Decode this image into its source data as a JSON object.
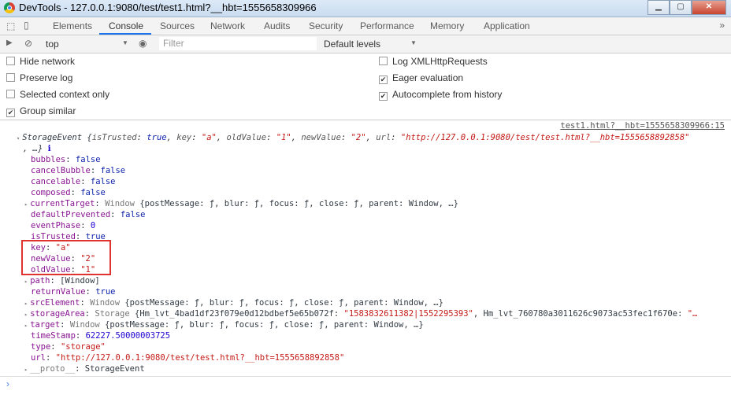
{
  "window": {
    "title": "DevTools - 127.0.0.1:9080/test/test1.html?__hbt=1555658309966",
    "controls": [
      "minimize",
      "maximize",
      "close"
    ]
  },
  "tabs": [
    "Elements",
    "Console",
    "Sources",
    "Network",
    "Audits",
    "Security",
    "Performance",
    "Memory",
    "Application"
  ],
  "active_tab": "Console",
  "toolbar": {
    "context": "top",
    "filter_placeholder": "Filter",
    "levels": "Default levels"
  },
  "settings": {
    "left": [
      {
        "label": "Hide network",
        "checked": false
      },
      {
        "label": "Preserve log",
        "checked": false
      },
      {
        "label": "Selected context only",
        "checked": false
      },
      {
        "label": "Group similar",
        "checked": true
      }
    ],
    "right": [
      {
        "label": "Log XMLHttpRequests",
        "checked": false
      },
      {
        "label": "Eager evaluation",
        "checked": true
      },
      {
        "label": "Autocomplete from history",
        "checked": true
      }
    ]
  },
  "console": {
    "source_link": "test1.html?__hbt=1555658309966:15",
    "lines": [
      {
        "indent": 0,
        "tri": "▾",
        "segs": [
          [
            "StorageEvent {",
            "p i"
          ],
          [
            "isTrusted",
            "ke i"
          ],
          [
            ": ",
            "p i"
          ],
          [
            "true",
            "b i"
          ],
          [
            ", ",
            "p i"
          ],
          [
            "key",
            "ke i"
          ],
          [
            ": ",
            "p i"
          ],
          [
            "\"a\"",
            "s i"
          ],
          [
            ", ",
            "p i"
          ],
          [
            "oldValue",
            "ke i"
          ],
          [
            ": ",
            "p i"
          ],
          [
            "\"1\"",
            "s i"
          ],
          [
            ", ",
            "p i"
          ],
          [
            "newValue",
            "ke i"
          ],
          [
            ": ",
            "p i"
          ],
          [
            "\"2\"",
            "s i"
          ],
          [
            ", ",
            "p i"
          ],
          [
            "url",
            "ke i"
          ],
          [
            ": ",
            "p i"
          ],
          [
            "\"http://127.0.0.1:9080/test/test.html?__hbt=1555658892858\"",
            "s i"
          ]
        ]
      },
      {
        "indent": 0,
        "segs": [
          [
            ", …} ",
            "p i"
          ],
          [
            "ℹ",
            "n"
          ]
        ]
      },
      {
        "indent": 1,
        "segs": [
          [
            "bubbles",
            "k"
          ],
          [
            ": ",
            "p"
          ],
          [
            "false",
            "b"
          ]
        ]
      },
      {
        "indent": 1,
        "segs": [
          [
            "cancelBubble",
            "k"
          ],
          [
            ": ",
            "p"
          ],
          [
            "false",
            "b"
          ]
        ]
      },
      {
        "indent": 1,
        "segs": [
          [
            "cancelable",
            "k"
          ],
          [
            ": ",
            "p"
          ],
          [
            "false",
            "b"
          ]
        ]
      },
      {
        "indent": 1,
        "segs": [
          [
            "composed",
            "k"
          ],
          [
            ": ",
            "p"
          ],
          [
            "false",
            "b"
          ]
        ]
      },
      {
        "indent": 1,
        "tri": "▸",
        "segs": [
          [
            "currentTarget",
            "k"
          ],
          [
            ": ",
            "p"
          ],
          [
            "Window ",
            "g"
          ],
          [
            "{postMessage: ƒ, blur: ƒ, focus: ƒ, close: ƒ, parent: Window, …}",
            "p"
          ]
        ]
      },
      {
        "indent": 1,
        "segs": [
          [
            "defaultPrevented",
            "k"
          ],
          [
            ": ",
            "p"
          ],
          [
            "false",
            "b"
          ]
        ]
      },
      {
        "indent": 1,
        "segs": [
          [
            "eventPhase",
            "k"
          ],
          [
            ": ",
            "p"
          ],
          [
            "0",
            "n"
          ]
        ]
      },
      {
        "indent": 1,
        "segs": [
          [
            "isTrusted",
            "k"
          ],
          [
            ": ",
            "p"
          ],
          [
            "true",
            "b"
          ]
        ]
      },
      {
        "indent": 1,
        "segs": [
          [
            "key",
            "k"
          ],
          [
            ": ",
            "p"
          ],
          [
            "\"a\"",
            "s"
          ]
        ]
      },
      {
        "indent": 1,
        "segs": [
          [
            "newValue",
            "k"
          ],
          [
            ": ",
            "p"
          ],
          [
            "\"2\"",
            "s"
          ]
        ]
      },
      {
        "indent": 1,
        "segs": [
          [
            "oldValue",
            "k"
          ],
          [
            ": ",
            "p"
          ],
          [
            "\"1\"",
            "s"
          ]
        ]
      },
      {
        "indent": 1,
        "tri": "▸",
        "segs": [
          [
            "path",
            "k"
          ],
          [
            ": ",
            "p"
          ],
          [
            "[Window]",
            "p"
          ]
        ]
      },
      {
        "indent": 1,
        "segs": [
          [
            "returnValue",
            "k"
          ],
          [
            ": ",
            "p"
          ],
          [
            "true",
            "b"
          ]
        ]
      },
      {
        "indent": 1,
        "tri": "▸",
        "segs": [
          [
            "srcElement",
            "k"
          ],
          [
            ": ",
            "p"
          ],
          [
            "Window ",
            "g"
          ],
          [
            "{postMessage: ƒ, blur: ƒ, focus: ƒ, close: ƒ, parent: Window, …}",
            "p"
          ]
        ]
      },
      {
        "indent": 1,
        "tri": "▸",
        "segs": [
          [
            "storageArea",
            "k"
          ],
          [
            ": ",
            "p"
          ],
          [
            "Storage ",
            "g"
          ],
          [
            "{Hm_lvt_4bad1df23f079e0d12bdbef5e65b072f: ",
            "p"
          ],
          [
            "\"1583832611382|1552295393\"",
            "s"
          ],
          [
            ", Hm_lvt_760780a3011626c9073ac53fec1f670e: ",
            "p"
          ],
          [
            "\"…",
            "s"
          ]
        ]
      },
      {
        "indent": 1,
        "tri": "▸",
        "segs": [
          [
            "target",
            "k"
          ],
          [
            ": ",
            "p"
          ],
          [
            "Window ",
            "g"
          ],
          [
            "{postMessage: ƒ, blur: ƒ, focus: ƒ, close: ƒ, parent: Window, …}",
            "p"
          ]
        ]
      },
      {
        "indent": 1,
        "segs": [
          [
            "timeStamp",
            "k"
          ],
          [
            ": ",
            "p"
          ],
          [
            "62227.50000003725",
            "n"
          ]
        ]
      },
      {
        "indent": 1,
        "segs": [
          [
            "type",
            "k"
          ],
          [
            ": ",
            "p"
          ],
          [
            "\"storage\"",
            "s"
          ]
        ]
      },
      {
        "indent": 1,
        "segs": [
          [
            "url",
            "k"
          ],
          [
            ": ",
            "p"
          ],
          [
            "\"http://127.0.0.1:9080/test/test.html?__hbt=1555658892858\"",
            "s"
          ]
        ]
      },
      {
        "indent": 1,
        "tri": "▸",
        "segs": [
          [
            "__proto__",
            "k g"
          ],
          [
            ": ",
            "p"
          ],
          [
            "StorageEvent",
            "p"
          ]
        ]
      }
    ],
    "prompt": "›"
  },
  "colors": {
    "accent": "#1a73e8",
    "highlight_box": "#e0322e"
  }
}
